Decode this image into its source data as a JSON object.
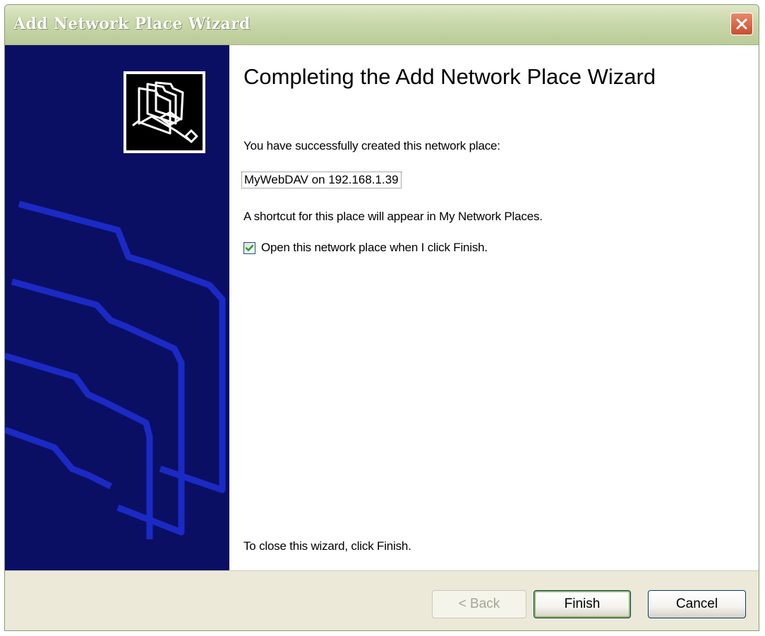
{
  "window": {
    "title": "Add Network Place Wizard",
    "close_icon": "close-icon"
  },
  "sidebar": {
    "icon": "network-folder-icon",
    "watermark": "folder-outline-watermark"
  },
  "content": {
    "heading": "Completing the Add Network Place Wizard",
    "intro": "You have successfully created this network place:",
    "place_name": "MyWebDAV on 192.168.1.39",
    "shortcut_note": "A shortcut for this place will appear in My Network Places.",
    "open_checkbox": {
      "label": "Open this network place when I click Finish.",
      "checked": true
    },
    "close_hint": "To close this wizard, click Finish."
  },
  "buttons": {
    "back": "< Back",
    "finish": "Finish",
    "cancel": "Cancel"
  },
  "colors": {
    "sidebar_bg": "#0a0f63",
    "titlebar": "#cbd9ac",
    "close_button": "#c94d2e",
    "dialog_bg": "#ece9d8"
  }
}
